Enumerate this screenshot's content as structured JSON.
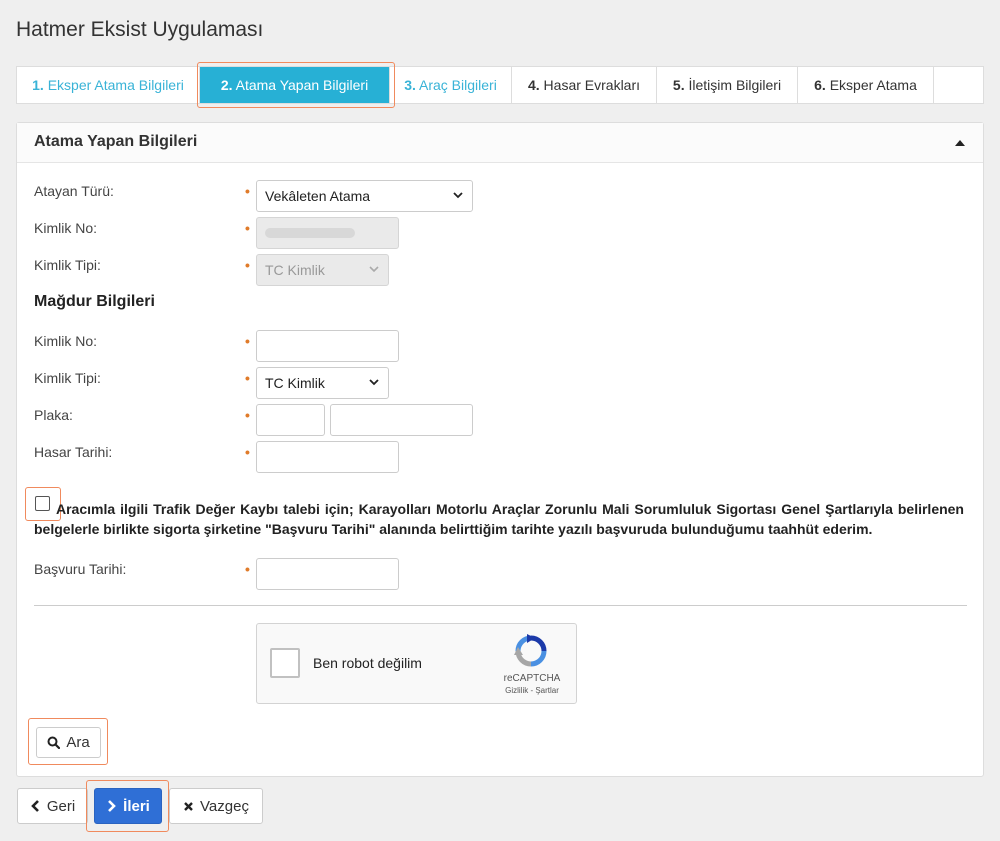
{
  "app": {
    "title": "Hatmer Eksist Uygulaması"
  },
  "tabs": [
    {
      "num": "1.",
      "label": "Eksper Atama Bilgileri"
    },
    {
      "num": "2.",
      "label": "Atama Yapan Bilgileri"
    },
    {
      "num": "3.",
      "label": "Araç Bilgileri"
    },
    {
      "num": "4.",
      "label": "Hasar Evrakları"
    },
    {
      "num": "5.",
      "label": "İletişim Bilgileri"
    },
    {
      "num": "6.",
      "label": "Eksper Atama"
    }
  ],
  "panel": {
    "title": "Atama Yapan Bilgileri",
    "required_mark": "•",
    "atayan": {
      "type_label": "Atayan Türü:",
      "type_value": "Vekâleten Atama",
      "id_label": "Kimlik No:",
      "id_type_label": "Kimlik Tipi:",
      "id_type_value": "TC Kimlik"
    },
    "magdur": {
      "section_title": "Mağdur Bilgileri",
      "id_label": "Kimlik No:",
      "id_type_label": "Kimlik Tipi:",
      "id_type_value": "TC Kimlik",
      "plate_label": "Plaka:",
      "damage_date_label": "Hasar Tarihi:"
    },
    "consent_text": "Aracımla ilgili Trafik Değer Kaybı talebi için; Karayolları Motorlu Araçlar Zorunlu Mali Sorumluluk Sigortası Genel Şartlarıyla belirlenen belgelerle birlikte sigorta şirketine \"Başvuru Tarihi\" alanında belirttiğim tarihte yazılı başvuruda bulunduğumu taahhüt ederim.",
    "application_date_label": "Başvuru Tarihi:",
    "recaptcha": {
      "label": "Ben robot değilim",
      "brand": "reCAPTCHA",
      "links": "Gizlilik - Şartlar"
    },
    "search_button": "Ara"
  },
  "footer": {
    "back": "Geri",
    "next": "İleri",
    "cancel": "Vazgeç"
  },
  "colors": {
    "tab_active": "#27b0d5",
    "tab_done": "#39b3d7",
    "primary": "#2f6fd6",
    "required": "#e07b2a",
    "highlight": "#f08a5d"
  }
}
